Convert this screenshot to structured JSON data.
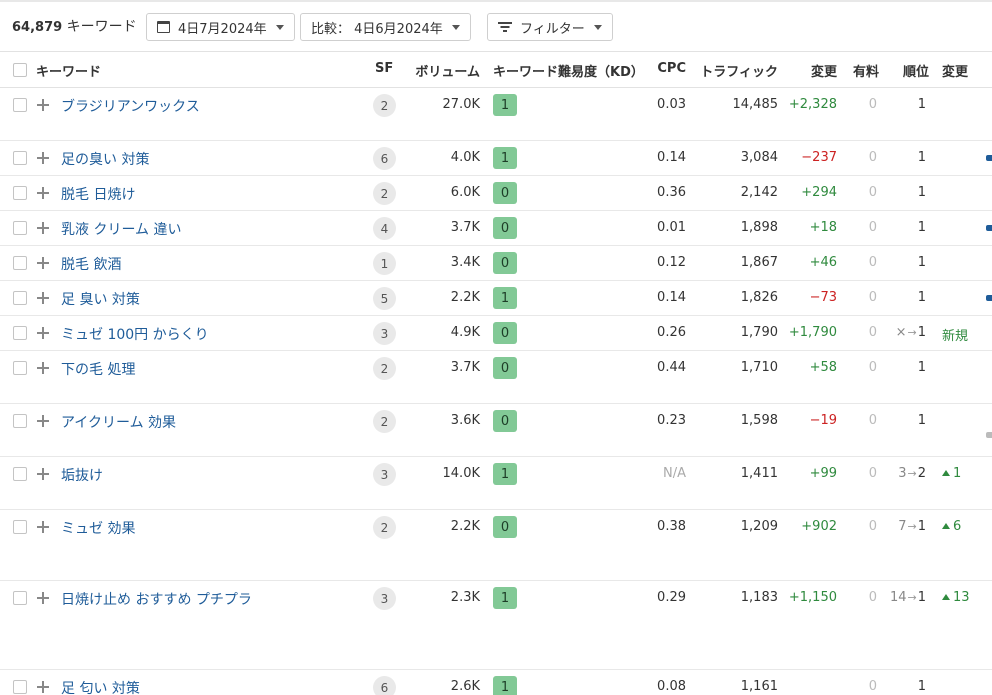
{
  "toolbar": {
    "count": "64,879",
    "count_label": "キーワード",
    "date_label": "4日7月2024年",
    "compare_label": "比較： 4日6月2024年",
    "filter_label": "フィルター"
  },
  "columns": {
    "keyword": "キーワード",
    "sf": "SF",
    "volume": "ボリューム",
    "kd": "キーワード難易度（KD）",
    "cpc": "CPC",
    "traffic": "トラフィック",
    "change": "変更",
    "paid": "有料",
    "position": "順位",
    "position_change": "変更"
  },
  "rows": [
    {
      "keyword": "ブラジリアンワックス",
      "sf": "2",
      "volume": "27.0K",
      "kd": "1",
      "cpc": "0.03",
      "traffic": "14,485",
      "change": "+2,328",
      "paid": "0",
      "pos_from": "",
      "pos_arrow": "",
      "pos": "1",
      "pos_change": "",
      "new_label": ""
    },
    {
      "keyword": "足の臭い 対策",
      "sf": "6",
      "volume": "4.0K",
      "kd": "1",
      "cpc": "0.14",
      "traffic": "3,084",
      "change": "−237",
      "paid": "0",
      "pos_from": "",
      "pos_arrow": "",
      "pos": "1",
      "pos_change": "",
      "new_label": ""
    },
    {
      "keyword": "脱毛 日焼け",
      "sf": "2",
      "volume": "6.0K",
      "kd": "0",
      "cpc": "0.36",
      "traffic": "2,142",
      "change": "+294",
      "paid": "0",
      "pos_from": "",
      "pos_arrow": "",
      "pos": "1",
      "pos_change": "",
      "new_label": ""
    },
    {
      "keyword": "乳液 クリーム 違い",
      "sf": "4",
      "volume": "3.7K",
      "kd": "0",
      "cpc": "0.01",
      "traffic": "1,898",
      "change": "+18",
      "paid": "0",
      "pos_from": "",
      "pos_arrow": "",
      "pos": "1",
      "pos_change": "",
      "new_label": ""
    },
    {
      "keyword": "脱毛 飲酒",
      "sf": "1",
      "volume": "3.4K",
      "kd": "0",
      "cpc": "0.12",
      "traffic": "1,867",
      "change": "+46",
      "paid": "0",
      "pos_from": "",
      "pos_arrow": "",
      "pos": "1",
      "pos_change": "",
      "new_label": ""
    },
    {
      "keyword": "足 臭い 対策",
      "sf": "5",
      "volume": "2.2K",
      "kd": "1",
      "cpc": "0.14",
      "traffic": "1,826",
      "change": "−73",
      "paid": "0",
      "pos_from": "",
      "pos_arrow": "",
      "pos": "1",
      "pos_change": "",
      "new_label": ""
    },
    {
      "keyword": "ミュゼ 100円 からくり",
      "sf": "3",
      "volume": "4.9K",
      "kd": "0",
      "cpc": "0.26",
      "traffic": "1,790",
      "change": "+1,790",
      "paid": "0",
      "pos_from": "×",
      "pos_arrow": "→",
      "pos": "1",
      "pos_change": "",
      "new_label": "新規"
    },
    {
      "keyword": "下の毛 処理",
      "sf": "2",
      "volume": "3.7K",
      "kd": "0",
      "cpc": "0.44",
      "traffic": "1,710",
      "change": "+58",
      "paid": "0",
      "pos_from": "",
      "pos_arrow": "",
      "pos": "1",
      "pos_change": "",
      "new_label": ""
    },
    {
      "keyword": "アイクリーム 効果",
      "sf": "2",
      "volume": "3.6K",
      "kd": "0",
      "cpc": "0.23",
      "traffic": "1,598",
      "change": "−19",
      "paid": "0",
      "pos_from": "",
      "pos_arrow": "",
      "pos": "1",
      "pos_change": "",
      "new_label": ""
    },
    {
      "keyword": "垢抜け",
      "sf": "3",
      "volume": "14.0K",
      "kd": "1",
      "cpc": "N/A",
      "traffic": "1,411",
      "change": "+99",
      "paid": "0",
      "pos_from": "3",
      "pos_arrow": "→",
      "pos": "2",
      "pos_change": "1",
      "new_label": ""
    },
    {
      "keyword": "ミュゼ 効果",
      "sf": "2",
      "volume": "2.2K",
      "kd": "0",
      "cpc": "0.38",
      "traffic": "1,209",
      "change": "+902",
      "paid": "0",
      "pos_from": "7",
      "pos_arrow": "→",
      "pos": "1",
      "pos_change": "6",
      "new_label": ""
    },
    {
      "keyword": "日焼け止め おすすめ プチプラ",
      "sf": "3",
      "volume": "2.3K",
      "kd": "1",
      "cpc": "0.29",
      "traffic": "1,183",
      "change": "+1,150",
      "paid": "0",
      "pos_from": "14",
      "pos_arrow": "→",
      "pos": "1",
      "pos_change": "13",
      "new_label": ""
    },
    {
      "keyword": "足 匂い 対策",
      "sf": "6",
      "volume": "2.6K",
      "kd": "1",
      "cpc": "0.08",
      "traffic": "1,161",
      "change": "",
      "paid": "0",
      "pos_from": "",
      "pos_arrow": "",
      "pos": "1",
      "pos_change": "",
      "new_label": ""
    }
  ]
}
